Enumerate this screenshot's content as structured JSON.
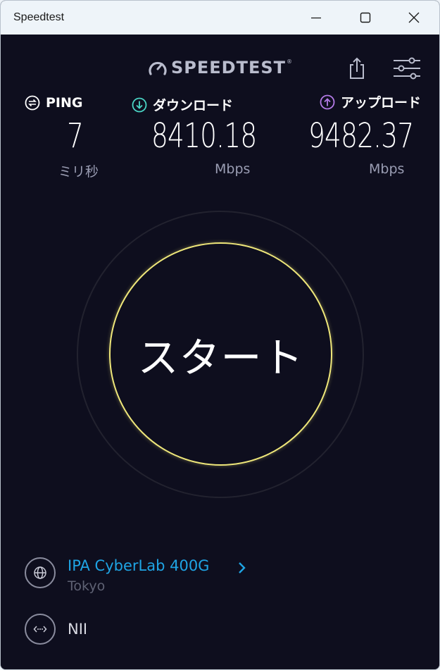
{
  "window": {
    "title": "Speedtest"
  },
  "brand": {
    "name": "SPEEDTEST",
    "tm": "®"
  },
  "metrics": {
    "ping": {
      "label": "PING",
      "value": "7",
      "unit": "ミリ秒"
    },
    "download": {
      "label": "ダウンロード",
      "value": "8410.18",
      "unit": "Mbps",
      "color": "#4ad6c6"
    },
    "upload": {
      "label": "アップロード",
      "value": "9482.37",
      "unit": "Mbps",
      "color": "#b57be8"
    }
  },
  "start": {
    "label": "スタート",
    "ring_color": "#efe77a"
  },
  "server": {
    "name": "IPA CyberLab 400G",
    "location": "Tokyo",
    "color": "#1fa4e4"
  },
  "isp": {
    "name": "NII"
  },
  "icons": {
    "window_controls": [
      "minimize-icon",
      "maximize-icon",
      "close-icon"
    ],
    "header": [
      "speedtest-logo-icon",
      "share-icon",
      "settings-sliders-icon"
    ],
    "metrics": [
      "ping-icon",
      "download-arrow-icon",
      "upload-arrow-icon"
    ],
    "footer": [
      "globe-icon",
      "chevron-right-icon",
      "connection-icon"
    ]
  }
}
